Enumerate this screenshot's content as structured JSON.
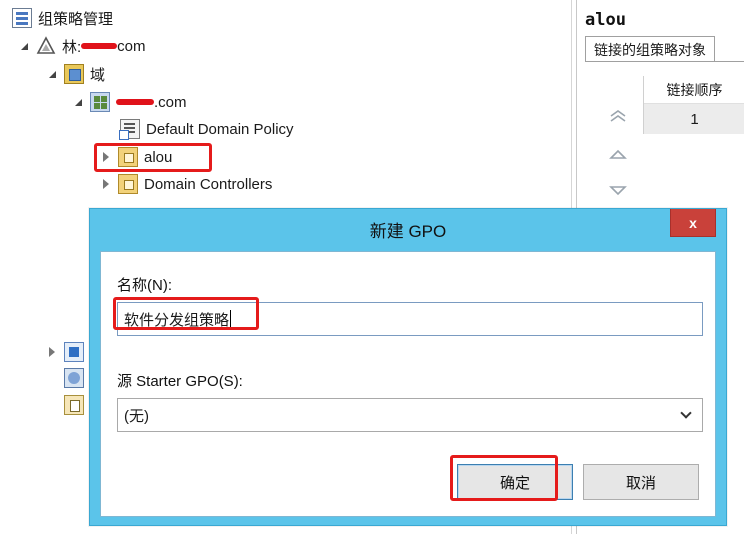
{
  "tree": {
    "root_label": "组策略管理",
    "forest_prefix": "林:",
    "forest_suffix": "com",
    "domains_label": "域",
    "domain_suffix": ".com",
    "items": [
      {
        "label": "Default Domain Policy"
      },
      {
        "label": "alou"
      },
      {
        "label": "Domain Controllers"
      }
    ]
  },
  "right_pane": {
    "title": "alou",
    "tab_label": "链接的组策略对象",
    "column_header": "链接顺序",
    "row_value": "1"
  },
  "dialog": {
    "title": "新建 GPO",
    "close_label": "x",
    "name_label": "名称(N):",
    "name_value": "软件分发组策略",
    "starter_label": "源 Starter GPO(S):",
    "starter_value": "(无)",
    "ok_label": "确定",
    "cancel_label": "取消"
  },
  "colors": {
    "dialog_frame": "#5bc4ea",
    "highlight": "#e51b1b",
    "close_button": "#c9413a"
  }
}
